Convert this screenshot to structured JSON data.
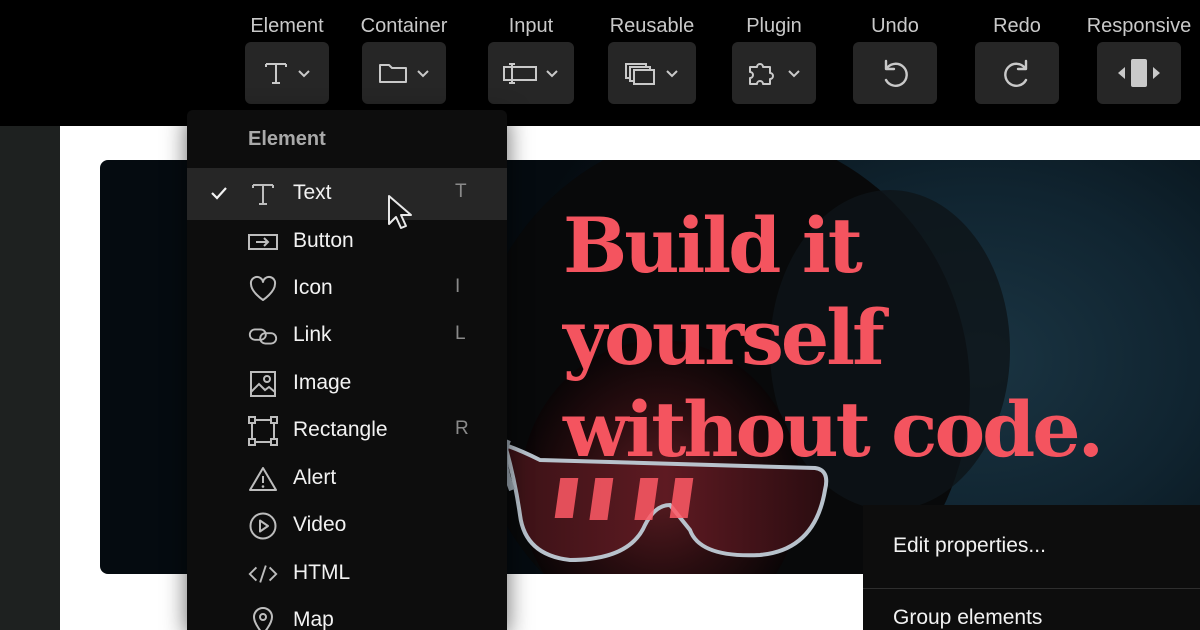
{
  "toolbar": {
    "items": [
      {
        "label": "Element",
        "icon": "text-t-icon"
      },
      {
        "label": "Container",
        "icon": "folder-icon"
      },
      {
        "label": "Input",
        "icon": "input-field-icon"
      },
      {
        "label": "Reusable",
        "icon": "stacked-layers-icon"
      },
      {
        "label": "Plugin",
        "icon": "puzzle-icon"
      },
      {
        "label": "Undo",
        "icon": "undo-icon"
      },
      {
        "label": "Redo",
        "icon": "redo-icon"
      },
      {
        "label": "Responsive",
        "icon": "responsive-icon"
      }
    ]
  },
  "element_menu": {
    "header": "Element",
    "items": [
      {
        "label": "Text",
        "shortcut": "T",
        "icon": "text-t-icon",
        "selected": true
      },
      {
        "label": "Button",
        "shortcut": "",
        "icon": "button-icon"
      },
      {
        "label": "Icon",
        "shortcut": "I",
        "icon": "heart-icon"
      },
      {
        "label": "Link",
        "shortcut": "L",
        "icon": "link-icon"
      },
      {
        "label": "Image",
        "shortcut": "",
        "icon": "image-icon"
      },
      {
        "label": "Rectangle",
        "shortcut": "R",
        "icon": "rectangle-icon"
      },
      {
        "label": "Alert",
        "shortcut": "",
        "icon": "alert-triangle-icon"
      },
      {
        "label": "Video",
        "shortcut": "",
        "icon": "play-circle-icon"
      },
      {
        "label": "HTML",
        "shortcut": "",
        "icon": "code-icon"
      },
      {
        "label": "Map",
        "shortcut": "",
        "icon": "map-pin-icon"
      }
    ]
  },
  "hero": {
    "headline_line1": "Build it yourself",
    "headline_line2": "without code."
  },
  "context_menu": {
    "items": [
      "Edit properties...",
      "Group elements"
    ]
  },
  "colors": {
    "accent": "#f4545f",
    "toolbar_bg": "#000000",
    "button_bg": "#262626",
    "menu_bg": "#0d0d0d",
    "hero_bg": "#0b1b24"
  }
}
